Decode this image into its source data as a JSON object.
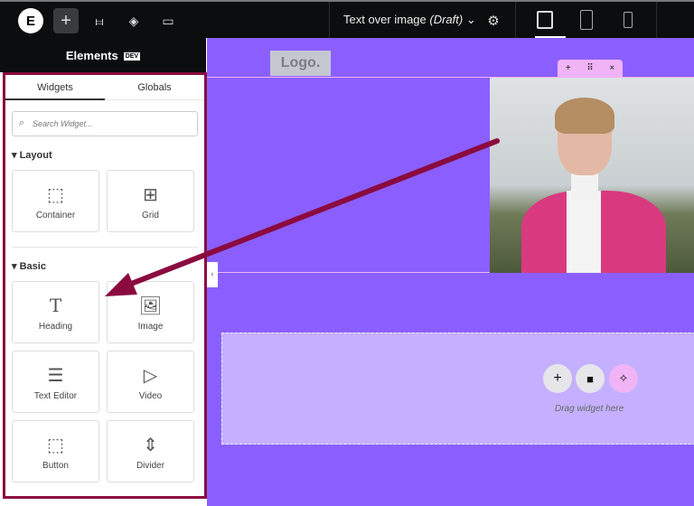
{
  "topbar": {
    "logo": "E",
    "add": "+",
    "settings": "⚙︎",
    "document_title": "Text over image",
    "status": "(Draft)",
    "chevron": "⌄",
    "gear": "⚙"
  },
  "panel": {
    "title": "Elements",
    "badge": "DEV",
    "tabs": [
      {
        "label": "Widgets"
      },
      {
        "label": "Globals"
      }
    ],
    "search_placeholder": "Search Widget...",
    "categories": [
      {
        "label": "Layout",
        "widgets": [
          {
            "label": "Container",
            "glyph": "⬚"
          },
          {
            "label": "Grid",
            "glyph": "⊞"
          }
        ]
      },
      {
        "label": "Basic",
        "widgets": [
          {
            "label": "Heading",
            "glyph": "T"
          },
          {
            "label": "Image",
            "glyph": "🖼"
          },
          {
            "label": "Text Editor",
            "glyph": "☰"
          },
          {
            "label": "Video",
            "glyph": "▷"
          },
          {
            "label": "Button",
            "glyph": "⬚"
          },
          {
            "label": "Divider",
            "glyph": "⇕"
          }
        ]
      }
    ]
  },
  "canvas": {
    "logo": "Logo.",
    "toolbar": [
      "+",
      "⠿",
      "×"
    ],
    "drop_text": "Drag widget here",
    "collapse": "‹"
  },
  "colors": {
    "canvas": "#8b5fff",
    "drop_zone": "#c4b0ff",
    "annotation": "#8a0b3f",
    "toolbar": "#f0b3f6"
  }
}
